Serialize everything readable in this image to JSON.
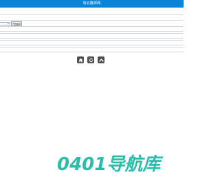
{
  "header": {
    "title": "有云翻译网"
  },
  "controls": {
    "select_value": "",
    "button_label": "开始翻译"
  },
  "nav_icons": [
    {
      "name": "home-icon"
    },
    {
      "name": "refresh-icon"
    },
    {
      "name": "up-icon"
    }
  ],
  "footer": {
    "watermark": "0401导航库"
  },
  "colors": {
    "topbar": "#0b84d8",
    "icon_bg": "#505050",
    "watermark": "#1ab8a6",
    "divider": "#cfd5dc"
  }
}
